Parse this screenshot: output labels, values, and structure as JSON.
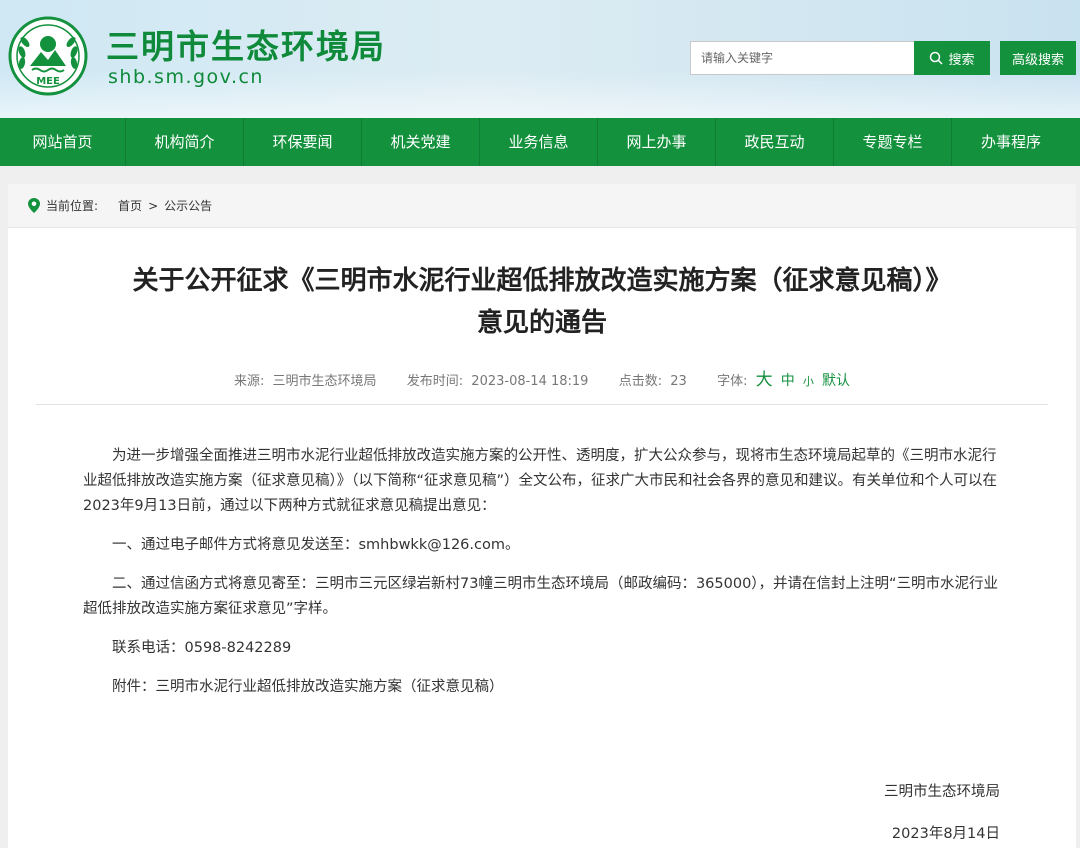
{
  "header": {
    "site_title": "三明市生态环境局",
    "site_domain": "shb.sm.gov.cn",
    "logo_text": "MEE",
    "search_placeholder": "请输入关键字",
    "search_label": "搜索",
    "advanced_search_label": "高级搜索"
  },
  "nav": {
    "items": [
      "网站首页",
      "机构简介",
      "环保要闻",
      "机关党建",
      "业务信息",
      "网上办事",
      "政民互动",
      "专题专栏",
      "办事程序"
    ]
  },
  "breadcrumb": {
    "label": "当前位置:",
    "home": "首页",
    "separator": ">",
    "current": "公示公告"
  },
  "article": {
    "title_line1": "关于公开征求《三明市水泥行业超低排放改造实施方案（征求意见稿）》",
    "title_line2": "意见的通告",
    "meta": {
      "source_label": "来源:",
      "source": "三明市生态环境局",
      "time_label": "发布时间:",
      "time": "2023-08-14 18:19",
      "clicks_label": "点击数:",
      "clicks": "23",
      "font_label": "字体:",
      "font_large": "大",
      "font_medium": "中",
      "font_small": "小",
      "font_default": "默认"
    },
    "paragraphs": [
      "为进一步增强全面推进三明市水泥行业超低排放改造实施方案的公开性、透明度，扩大公众参与，现将市生态环境局起草的《三明市水泥行业超低排放改造实施方案（征求意见稿）》（以下简称“征求意见稿”）全文公布，征求广大市民和社会各界的意见和建议。有关单位和个人可以在2023年9月13日前，通过以下两种方式就征求意见稿提出意见：",
      "一、通过电子邮件方式将意见发送至：smhbwkk@126.com。",
      "二、通过信函方式将意见寄至：三明市三元区绿岩新村73幢三明市生态环境局（邮政编码：365000），并请在信封上注明“三明市水泥行业超低排放改造实施方案征求意见”字样。",
      "联系电话：0598-8242289",
      "附件：三明市水泥行业超低排放改造实施方案（征求意见稿）"
    ],
    "signature": "三明市生态环境局",
    "date": "2023年8月14日"
  },
  "colors": {
    "brand_green": "#13913d",
    "title_green": "#0e8a3a"
  }
}
